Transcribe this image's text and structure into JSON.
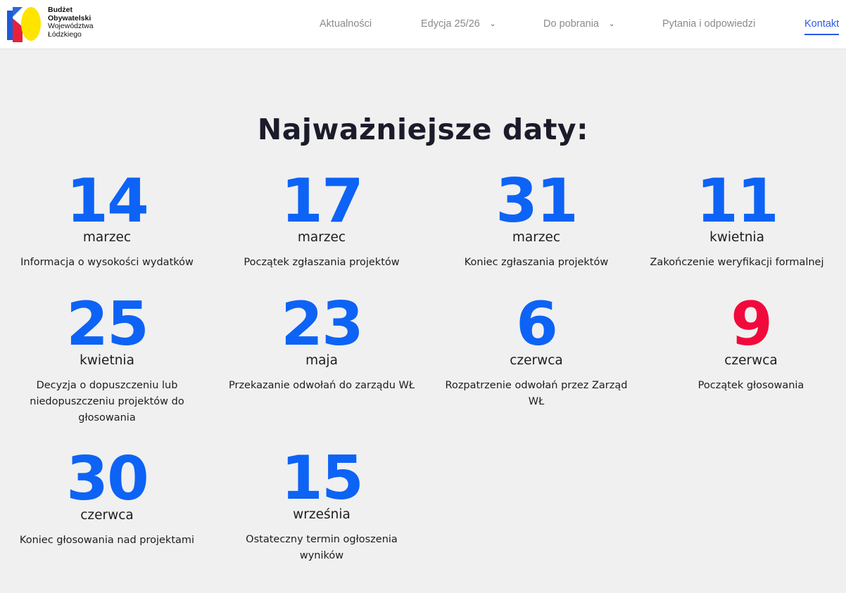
{
  "header": {
    "logo": {
      "line1": "Budżet",
      "line2": "Obywatelski",
      "line3": "Województwa",
      "line4": "Łódzkiego"
    },
    "nav": [
      {
        "label": "Aktualności",
        "dropdown": false
      },
      {
        "label": "Edycja 25/26",
        "dropdown": true
      },
      {
        "label": "Do pobrania",
        "dropdown": true
      },
      {
        "label": "Pytania i odpowiedzi",
        "dropdown": false
      },
      {
        "label": "Kontakt",
        "dropdown": false,
        "active": true
      }
    ]
  },
  "main": {
    "heading": "Najważniejsze daty:",
    "dates": [
      {
        "day": "14",
        "month": "marzec",
        "desc": "Informacja o wysokości wydatków"
      },
      {
        "day": "17",
        "month": "marzec",
        "desc": "Początek zgłaszania projektów"
      },
      {
        "day": "31",
        "month": "marzec",
        "desc": "Koniec zgłaszania projektów"
      },
      {
        "day": "11",
        "month": "kwietnia",
        "desc": "Zakończenie weryfikacji formalnej"
      },
      {
        "day": "25",
        "month": "kwietnia",
        "desc": "Decyzja o dopuszczeniu lub niedopuszczeniu projektów do głosowania"
      },
      {
        "day": "23",
        "month": "maja",
        "desc": "Przekazanie odwołań do zarządu WŁ"
      },
      {
        "day": "6",
        "month": "czerwca",
        "desc": "Rozpatrzenie odwołań przez Zarząd WŁ"
      },
      {
        "day": "9",
        "month": "czerwca",
        "desc": "Początek głosowania",
        "highlight": true
      },
      {
        "day": "30",
        "month": "czerwca",
        "desc": "Koniec głosowania nad projektami"
      },
      {
        "day": "15",
        "month": "września",
        "desc": "Ostateczny termin ogłoszenia wyników"
      }
    ]
  },
  "colors": {
    "accent_blue": "#0d63f5",
    "highlight_red": "#f2093c",
    "nav_active": "#2b59e8",
    "background": "#f0f0f0"
  }
}
